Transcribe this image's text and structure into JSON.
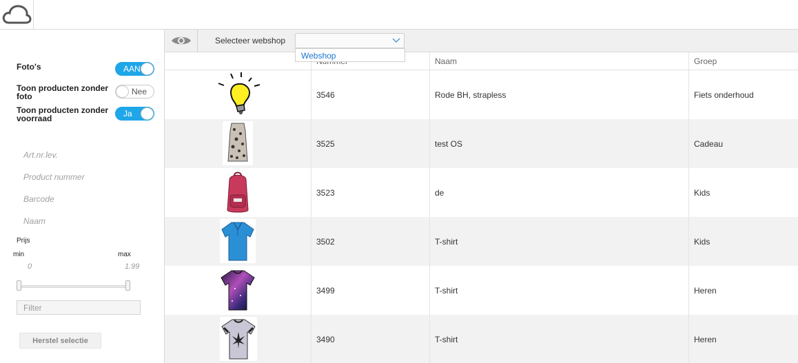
{
  "sidebar": {
    "options": [
      {
        "label": "Foto's",
        "toggle": "AAN",
        "state": "on"
      },
      {
        "label": "Toon producten zonder foto",
        "toggle": "Nee",
        "state": "off"
      },
      {
        "label": "Toon producten zonder voorraad",
        "toggle": "Ja",
        "state": "on"
      }
    ],
    "fields": {
      "art_nr": "Art.nr.lev.",
      "product_nummer": "Product nummer",
      "barcode": "Barcode",
      "naam": "Naam"
    },
    "price": {
      "label": "Prijs",
      "min_label": "min",
      "max_label": "max",
      "min_value": "0",
      "max_value": "1.99"
    },
    "filter_placeholder": "Filter",
    "reset_label": "Herstel selectie"
  },
  "toolbar": {
    "webshop_label": "Selecteer webshop",
    "webshop_value": "",
    "dropdown_option": "Webshop"
  },
  "table": {
    "headers": {
      "nummer": "Nummer",
      "naam": "Naam",
      "groep": "Groep"
    },
    "rows": [
      {
        "nummer": "3546",
        "naam": "Rode BH, strapless",
        "groep": "Fiets onderhoud",
        "image": "lightbulb-icon"
      },
      {
        "nummer": "3525",
        "naam": "test OS",
        "groep": "Cadeau",
        "image": "dress-image"
      },
      {
        "nummer": "3523",
        "naam": "de",
        "groep": "Kids",
        "image": "backpack-image"
      },
      {
        "nummer": "3502",
        "naam": "T-shirt",
        "groep": "Kids",
        "image": "polo-shirt-image"
      },
      {
        "nummer": "3499",
        "naam": "T-shirt",
        "groep": "Heren",
        "image": "galaxy-tshirt-image"
      },
      {
        "nummer": "3490",
        "naam": "T-shirt",
        "groep": "Heren",
        "image": "print-tshirt-image"
      }
    ]
  },
  "colors": {
    "accent": "#1fa6e8",
    "row_alt": "#f2f2f2",
    "link": "#1976d2"
  }
}
